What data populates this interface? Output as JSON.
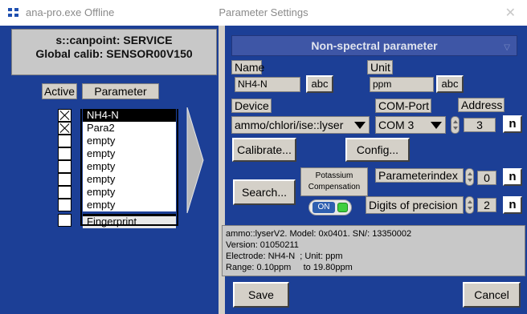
{
  "titlebar": {
    "app_title": "ana-pro.exe  Offline",
    "window_title": "Parameter Settings",
    "close_glyph": "✕"
  },
  "header": {
    "line1": "s::canpoint: SERVICE",
    "line2": "Global calib: SENSOR00V150"
  },
  "columns": {
    "active": "Active",
    "parameter": "Parameter"
  },
  "parameters": [
    {
      "label": "NH4-N",
      "active": true
    },
    {
      "label": "Para2",
      "active": true
    },
    {
      "label": "empty",
      "active": false
    },
    {
      "label": "empty",
      "active": false
    },
    {
      "label": "empty",
      "active": false
    },
    {
      "label": "empty",
      "active": false
    },
    {
      "label": "empty",
      "active": false
    },
    {
      "label": "empty",
      "active": false
    },
    {
      "label": "Fingerprint",
      "active": false
    }
  ],
  "panel": {
    "title": "Non-spectral parameter",
    "name_label": "Name",
    "name_value": "NH4-N",
    "abc": "abc",
    "unit_label": "Unit",
    "unit_value": "ppm",
    "device_label": "Device",
    "device_value": "ammo/chlori/ise::lyser",
    "com_label": "COM-Port",
    "com_value": "COM 3",
    "address_label": "Address",
    "address_value": "3",
    "n": "n",
    "calibrate": "Calibrate...",
    "config": "Config...",
    "search": "Search...",
    "comp_line1": "Potassium",
    "comp_line2": "Compensation",
    "toggle": "ON",
    "paramindex_label": "Parameterindex",
    "paramindex_value": "0",
    "digits_label": "Digits of precision",
    "digits_value": "2",
    "info": [
      "ammo::lyserV2. Model: 0x0401. SN/: 13350002",
      "Version: 01050211",
      "Electrode: NH4-N  ; Unit: ppm",
      "Range: 0.10ppm     to 19.80ppm"
    ],
    "save": "Save",
    "cancel": "Cancel"
  },
  "colors": {
    "background": "#1c3f96",
    "panel_title": "#3e56a6",
    "control": "#d4d0c8",
    "led": "#3fcf3f"
  },
  "icons": [
    "app-icon",
    "close-icon",
    "dropdown-arrow-icon",
    "spinner-icon",
    "led-indicator-icon",
    "right-arrow-icon"
  ]
}
